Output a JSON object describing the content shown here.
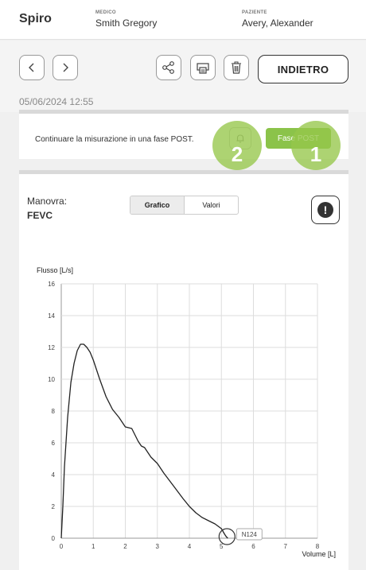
{
  "header": {
    "app_title": "Spiro",
    "medico_label": "MEDICO",
    "medico_value": "Smith Gregory",
    "paziente_label": "PAZIENTE",
    "paziente_value": "Avery, Alexander"
  },
  "toolbar": {
    "back_label": "INDIETRO",
    "timestamp": "05/06/2024 12:55",
    "icons": [
      "chevron-left-icon",
      "chevron-right-icon",
      "share-icon",
      "print-icon",
      "trash-icon"
    ]
  },
  "notice": {
    "text": "Continuare la misurazione in una fase POST.",
    "post_button_label": "Fase POST",
    "callout_1": "1",
    "callout_2": "2"
  },
  "panel": {
    "manovra_label": "Manovra:",
    "manovra_value": "FEVC",
    "tabs": [
      {
        "label": "Grafico",
        "active": true
      },
      {
        "label": "Valori",
        "active": false
      }
    ]
  },
  "chart_data": {
    "type": "line",
    "ylabel": "Flusso [L/s]",
    "xlabel": "Volume [L]",
    "xlim": [
      0,
      8
    ],
    "ylim": [
      0,
      16
    ],
    "x_ticks": [
      "0",
      "1",
      "2",
      "3",
      "4",
      "5",
      "6",
      "7",
      "8"
    ],
    "y_ticks": [
      "0",
      "2",
      "4",
      "6",
      "8",
      "10",
      "12",
      "14",
      "16"
    ],
    "grid": true,
    "annotation": "N124",
    "annotation_x": 5.2,
    "series": [
      {
        "color": "#222222",
        "x": [
          0,
          0.05,
          0.1,
          0.2,
          0.3,
          0.4,
          0.5,
          0.6,
          0.7,
          0.8,
          0.9,
          1.0,
          1.2,
          1.4,
          1.6,
          1.8,
          2.0,
          2.2,
          2.4,
          2.5,
          2.6,
          2.8,
          3.0,
          3.2,
          3.5,
          3.8,
          4.0,
          4.2,
          4.4,
          4.6,
          4.8,
          5.0,
          5.1,
          5.15,
          5.2
        ],
        "y": [
          0,
          2.0,
          4.5,
          7.6,
          9.8,
          11.0,
          11.8,
          12.2,
          12.2,
          12.0,
          11.7,
          11.2,
          10.0,
          8.9,
          8.1,
          7.6,
          7.0,
          6.9,
          6.1,
          5.8,
          5.7,
          5.1,
          4.7,
          4.1,
          3.3,
          2.5,
          2.0,
          1.6,
          1.3,
          1.1,
          0.9,
          0.6,
          0.25,
          0.1,
          0
        ]
      }
    ]
  }
}
